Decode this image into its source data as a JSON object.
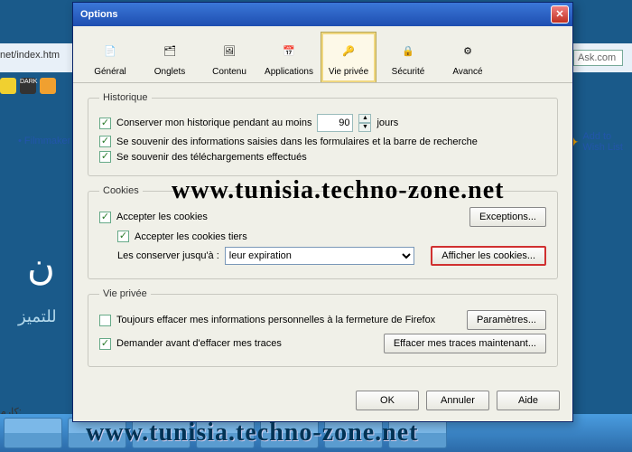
{
  "background": {
    "url": "net/index.htm",
    "search_placeholder": "Ask.com",
    "filmmaker_link": "Filmmaker",
    "wishlist_l1": "Add to",
    "wishlist_l2": "Wish List",
    "arabic_main": "ن",
    "arabic_sub": "للتميز",
    "bottom_arabic": ":کارم"
  },
  "watermark": "www.tunisia.techno-zone.net",
  "dialog": {
    "title": "Options",
    "tabs": [
      {
        "label": "Général",
        "icon": "📄"
      },
      {
        "label": "Onglets",
        "icon": "🗂"
      },
      {
        "label": "Contenu",
        "icon": "🖼"
      },
      {
        "label": "Applications",
        "icon": "📅"
      },
      {
        "label": "Vie privée",
        "icon": "🔑"
      },
      {
        "label": "Sécurité",
        "icon": "🔒"
      },
      {
        "label": "Avancé",
        "icon": "⚙"
      }
    ],
    "historique": {
      "legend": "Historique",
      "keep_history": "Conserver mon historique pendant au moins",
      "days_value": "90",
      "days_suffix": "jours",
      "remember_forms": "Se souvenir des informations saisies dans les formulaires et la barre de recherche",
      "remember_downloads": "Se souvenir des téléchargements effectués"
    },
    "cookies": {
      "legend": "Cookies",
      "accept": "Accepter les cookies",
      "accept_third": "Accepter les cookies tiers",
      "keep_until_label": "Les conserver jusqu'à :",
      "keep_until_value": "leur expiration",
      "exceptions_btn": "Exceptions...",
      "show_cookies_btn": "Afficher les cookies..."
    },
    "privacy": {
      "legend": "Vie privée",
      "always_clear": "Toujours effacer mes informations personnelles à la fermeture de Firefox",
      "ask_before": "Demander avant d'effacer mes traces",
      "settings_btn": "Paramètres...",
      "clear_now_btn": "Effacer mes traces maintenant..."
    },
    "buttons": {
      "ok": "OK",
      "cancel": "Annuler",
      "help": "Aide"
    }
  }
}
